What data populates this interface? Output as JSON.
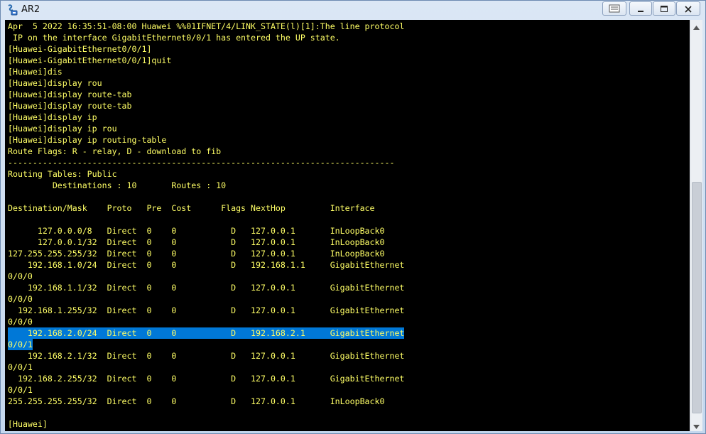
{
  "window": {
    "title": "AR2",
    "icon": "router-terminal-icon",
    "controls": [
      "extra-icon",
      "minimize-icon",
      "maximize-icon",
      "close-icon"
    ]
  },
  "colors": {
    "terminal_bg": "#000000",
    "terminal_fg": "#ffff66",
    "selection_bg": "#0078d7"
  },
  "terminal": {
    "lines": [
      "Apr  5 2022 16:35:51-08:00 Huawei %%01IFNET/4/LINK_STATE(l)[1]:The line protocol",
      " IP on the interface GigabitEthernet0/0/1 has entered the UP state.",
      "[Huawei-GigabitEthernet0/0/1]",
      "[Huawei-GigabitEthernet0/0/1]quit",
      "[Huawei]dis",
      "[Huawei]display rou",
      "[Huawei]display route-tab",
      "[Huawei]display route-tab",
      "[Huawei]display ip",
      "[Huawei]display ip rou",
      "[Huawei]display ip routing-table",
      "Route Flags: R - relay, D - download to fib",
      "------------------------------------------------------------------------------",
      "Routing Tables: Public",
      "         Destinations : 10       Routes : 10",
      "",
      "Destination/Mask    Proto   Pre  Cost      Flags NextHop         Interface",
      "",
      "      127.0.0.0/8   Direct  0    0           D   127.0.0.1       InLoopBack0",
      "      127.0.0.1/32  Direct  0    0           D   127.0.0.1       InLoopBack0",
      "127.255.255.255/32  Direct  0    0           D   127.0.0.1       InLoopBack0",
      "    192.168.1.0/24  Direct  0    0           D   192.168.1.1     GigabitEthernet",
      "0/0/0",
      "    192.168.1.1/32  Direct  0    0           D   127.0.0.1       GigabitEthernet",
      "0/0/0",
      "  192.168.1.255/32  Direct  0    0           D   127.0.0.1       GigabitEthernet",
      "0/0/0",
      "    192.168.2.0/24  Direct  0    0           D   192.168.2.1     GigabitEthernet",
      "0/0/1",
      "    192.168.2.1/32  Direct  0    0           D   127.0.0.1       GigabitEthernet",
      "0/0/1",
      "  192.168.2.255/32  Direct  0    0           D   127.0.0.1       GigabitEthernet",
      "0/0/1",
      "255.255.255.255/32  Direct  0    0           D   127.0.0.1       InLoopBack0",
      "",
      "[Huawei]"
    ],
    "selected_lines": [
      27,
      28
    ]
  },
  "scrollbar": {
    "up_icon": "scroll-up-arrow-icon",
    "down_icon": "scroll-down-arrow-icon"
  }
}
